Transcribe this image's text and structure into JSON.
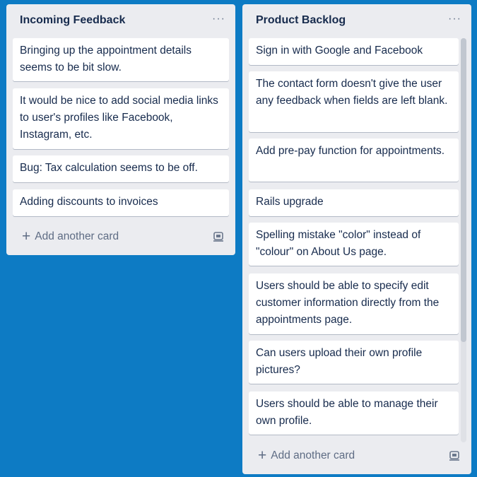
{
  "lists": [
    {
      "title": "Incoming Feedback",
      "menu_icon": "ellipsis-icon",
      "cards": [
        "Bringing up the appointment details seems to be bit slow.",
        "It would be nice to add social media links to user's profiles like Facebook, Instagram, etc.",
        "Bug: Tax calculation seems to be off.",
        "Adding discounts to invoices"
      ],
      "add_card_label": "Add another card"
    },
    {
      "title": "Product Backlog",
      "menu_icon": "ellipsis-icon",
      "cards": [
        "Sign in with Google and Facebook",
        "The contact form doesn't give the user any feedback when fields are left blank.",
        "Add pre-pay function for appointments.",
        "Rails upgrade",
        "Spelling mistake \"color\" instead of \"colour\" on About Us page.",
        "Users should be able to specify edit customer information directly from the appointments page.",
        "Can users upload their own profile pictures?",
        "Users should be able to manage their own profile."
      ],
      "add_card_label": "Add another card"
    }
  ],
  "colors": {
    "board_background": "#0d7bc4",
    "list_background": "#ebecf0",
    "card_background": "#ffffff",
    "text": "#172b4d",
    "muted_text": "#5e6c84"
  }
}
